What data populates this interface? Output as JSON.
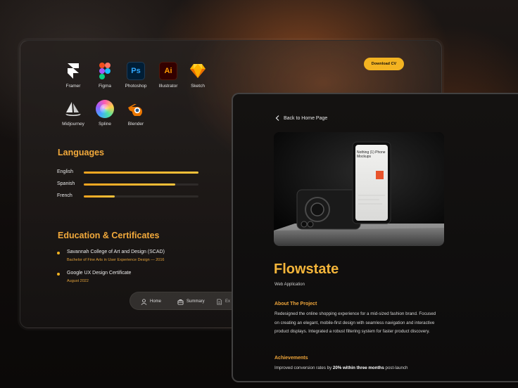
{
  "left_panel": {
    "download_button": "Download CV",
    "tools": [
      {
        "label": "Framer",
        "icon": "framer-icon"
      },
      {
        "label": "Figma",
        "icon": "figma-icon"
      },
      {
        "label": "Photoshop",
        "icon": "photoshop-icon",
        "glyph": "Ps"
      },
      {
        "label": "Illustrator",
        "icon": "illustrator-icon",
        "glyph": "Ai"
      },
      {
        "label": "Sketch",
        "icon": "sketch-icon"
      },
      {
        "label": "Midjourney",
        "icon": "midjourney-icon"
      },
      {
        "label": "Spline",
        "icon": "spline-icon"
      },
      {
        "label": "Blender",
        "icon": "blender-icon"
      }
    ],
    "languages": {
      "title": "Languages",
      "items": [
        {
          "name": "English",
          "level": 1.0
        },
        {
          "name": "Spanish",
          "level": 0.8
        },
        {
          "name": "French",
          "level": 0.27
        }
      ]
    },
    "education": {
      "title": "Education & Certificates",
      "items": [
        {
          "title": "Savannah College of Art and Design (SCAD)",
          "subtitle": "Bachelor of Fine Arts in User Experience Design — 2016"
        },
        {
          "title": "Google UX Design Certificate",
          "subtitle": "August 2022"
        }
      ]
    },
    "nav": {
      "home": "Home",
      "summary": "Summary",
      "third": "Ex"
    }
  },
  "right_panel": {
    "back_link": "Back to Home Page",
    "phone_text": "Nothing (1) Phone Mockups",
    "project_title": "Flowstate",
    "project_subtitle": "Web Application",
    "about_title": "About The Project",
    "about_text": "Redesigned the online shopping experience for a mid-sized fashion brand. Focused on creating an elegant, mobile-first design with seamless navigation and interactive product displays. Integrated a robust filtering system for faster product discovery.",
    "achievements_title": "Achievements",
    "achievements_pre": "Improved conversion rates by ",
    "achievements_bold": "20% within three months",
    "achievements_post": " post-launch"
  },
  "colors": {
    "accent": "#f3b321",
    "heading": "#f2a93b"
  }
}
